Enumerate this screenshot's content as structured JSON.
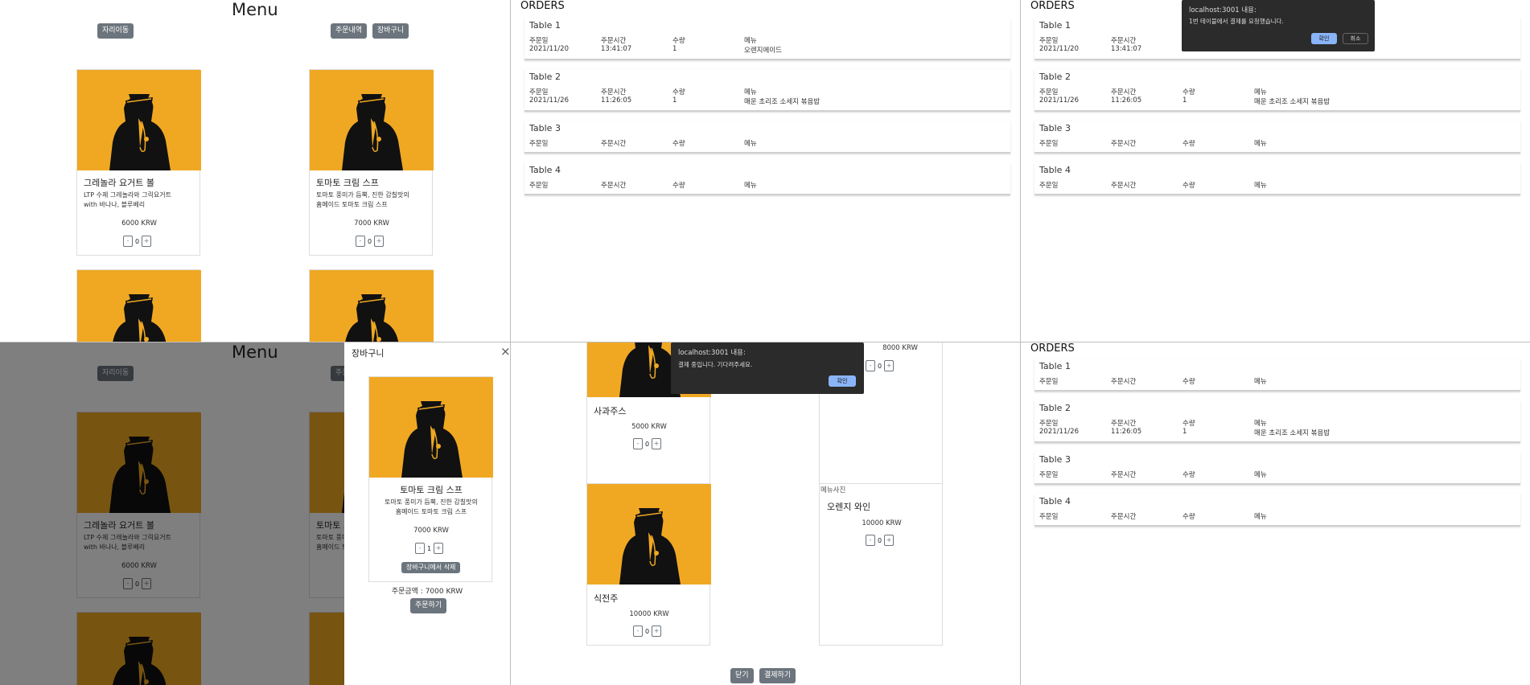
{
  "menu": {
    "title": "Menu",
    "seat_move_label": "자리이동",
    "order_history_label": "주문내역",
    "cart_label": "장바구니",
    "items": [
      {
        "name": "그레놀라 요거트 볼",
        "desc_line1": "LTP 수제 그레놀라와 그릭요거트",
        "desc_line2": "with 바나나, 블루베리",
        "price": "6000 KRW",
        "qty": "0"
      },
      {
        "name": "토마토 크림 스프",
        "desc_line1": "토마토 풍미가 듬뿍, 진한 감칠맛의",
        "desc_line2": "홈메이드 토마토 크림 스프",
        "price": "7000 KRW",
        "qty": "0"
      }
    ],
    "minus": "-",
    "plus": "+"
  },
  "orders": {
    "title": "ORDERS",
    "headers": [
      "주문일",
      "주문시간",
      "수량",
      "메뉴"
    ],
    "tables": [
      {
        "name": "Table 1",
        "date": "2021/11/20",
        "time": "13:41:07",
        "qty": "1",
        "menu": "오렌지에이드"
      },
      {
        "name": "Table 2",
        "date": "2021/11/26",
        "time": "11:26:05",
        "qty": "1",
        "menu": "매운 초리조 소세지 볶음밥"
      },
      {
        "name": "Table 3"
      },
      {
        "name": "Table 4"
      }
    ]
  },
  "dialog_payment_request": {
    "title": "localhost:3001 내용:",
    "message": "1번 테이블에서 결제를 요청했습니다.",
    "ok": "확인",
    "cancel": "취소"
  },
  "cart_modal": {
    "title": "장바구니",
    "close": "×",
    "item_name": "토마토 크림 스프",
    "item_desc_line1": "토마토 풍미가 듬뿍, 진한 감칠맛의",
    "item_desc_line2": "홈메이드 토마토 크림 스프",
    "item_price": "7000 KRW",
    "item_qty": "1",
    "remove_label": "장바구니에서 삭제",
    "total": "주문금액 : 7000 KRW",
    "order_label": "주문하기"
  },
  "order_list_modal": {
    "items": [
      {
        "name": "사과주스",
        "price": "5000 KRW",
        "qty": "0"
      },
      {
        "name": "",
        "price": "8000 KRW",
        "qty": "0"
      },
      {
        "name": "식전주",
        "price": "10000 KRW",
        "qty": "0"
      },
      {
        "name": "오렌지 와인",
        "price": "10000 KRW",
        "qty": "0",
        "img_alt": "메뉴사진"
      }
    ],
    "close_label": "닫기",
    "pay_label": "결제하기"
  },
  "dialog_payment_progress": {
    "title": "localhost:3001 내용:",
    "message": "결제 중입니다. 기다려주세요.",
    "ok": "확인"
  },
  "colors": {
    "item_bg": "#f0a823",
    "button": "#6c757d",
    "dialog_bg": "#2b2b2b",
    "dialog_ok": "#8ab4f8"
  }
}
